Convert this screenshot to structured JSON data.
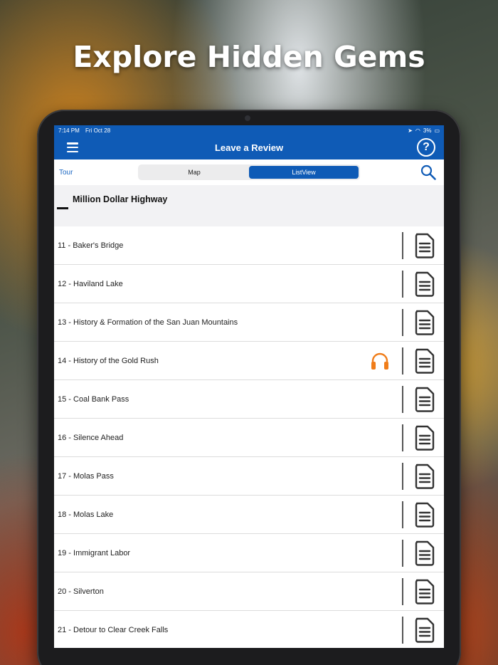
{
  "promo": {
    "headline": "Explore Hidden Gems"
  },
  "status_bar": {
    "time": "7:14 PM",
    "date": "Fri Oct 28",
    "battery": "3%"
  },
  "nav": {
    "title": "Leave a Review"
  },
  "toolbar": {
    "tour_label": "Tour",
    "segments": [
      {
        "label": "Map",
        "selected": false
      },
      {
        "label": "ListView",
        "selected": true
      }
    ]
  },
  "section": {
    "title": "Million Dollar Highway"
  },
  "list": {
    "items": [
      {
        "label": "11 - Baker's Bridge",
        "has_audio": false
      },
      {
        "label": "12 - Haviland Lake",
        "has_audio": false
      },
      {
        "label": "13 - History & Formation of the San Juan Mountains",
        "has_audio": false
      },
      {
        "label": "14 - History of the Gold Rush",
        "has_audio": true
      },
      {
        "label": "15 - Coal Bank Pass",
        "has_audio": false
      },
      {
        "label": "16 - Silence Ahead",
        "has_audio": false
      },
      {
        "label": "17 - Molas Pass",
        "has_audio": false
      },
      {
        "label": "18 - Molas Lake",
        "has_audio": false
      },
      {
        "label": "19 - Immigrant Labor",
        "has_audio": false
      },
      {
        "label": "20 - Silverton",
        "has_audio": false
      },
      {
        "label": "21 - Detour to Clear Creek Falls",
        "has_audio": false
      }
    ]
  },
  "colors": {
    "primary": "#0f5bb6",
    "audio": "#f07d1a"
  }
}
